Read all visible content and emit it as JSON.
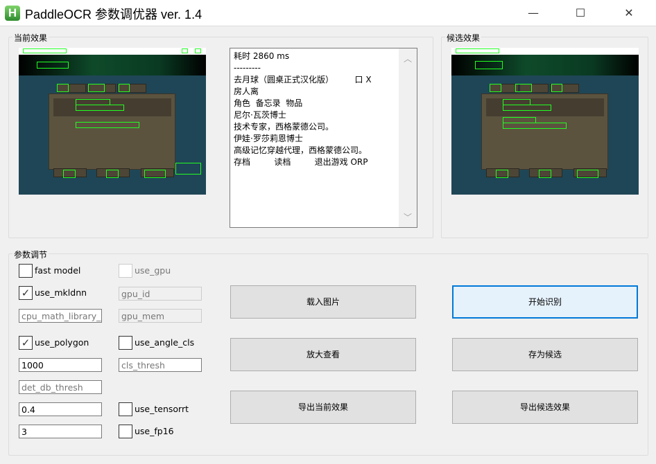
{
  "window": {
    "title": "PaddleOCR 参数调优器 ver. 1.4",
    "app_icon_letter": "H",
    "minimize": "—",
    "maximize": "☐",
    "close": "✕"
  },
  "current": {
    "label": "当前效果"
  },
  "candidate": {
    "label": "候选效果"
  },
  "ocr_output": {
    "lines": [
      "耗时 2860 ms",
      "---------",
      "去月球（圆桌正式汉化版）        口 X",
      "房人离",
      "角色  备忘录  物品",
      "尼尔·瓦茨博士",
      "技术专家，西格蒙德公司。",
      "伊娃·罗莎莉恩博士",
      "高级记忆穿越代理，西格蒙德公司。",
      "存档         读档         退出游戏 ORP"
    ]
  },
  "params": {
    "label": "参数调节",
    "fast_model": {
      "label": "fast model",
      "checked": false
    },
    "use_gpu": {
      "label": "use_gpu",
      "checked": false,
      "disabled": true
    },
    "use_mkldnn": {
      "label": "use_mkldnn",
      "checked": true
    },
    "gpu_id": {
      "placeholder": "gpu_id"
    },
    "cpu_math_library_num_threads": {
      "placeholder": "cpu_math_library_nu"
    },
    "gpu_mem": {
      "placeholder": "gpu_mem"
    },
    "use_polygon": {
      "label": "use_polygon",
      "checked": true
    },
    "use_angle_cls": {
      "label": "use_angle_cls",
      "checked": false
    },
    "max_side": {
      "value": "1000"
    },
    "cls_thresh": {
      "placeholder": "cls_thresh"
    },
    "det_db_thresh": {
      "placeholder": "det_db_thresh"
    },
    "box_thresh": {
      "value": "0.4"
    },
    "use_tensorrt": {
      "label": "use_tensorrt",
      "checked": false
    },
    "unclip": {
      "value": "3"
    },
    "use_fp16": {
      "label": "use_fp16",
      "checked": false
    }
  },
  "buttons": {
    "load": "载入图片",
    "start": "开始识别",
    "zoom": "放大查看",
    "save_candidate": "存为候选",
    "export_current": "导出当前效果",
    "export_candidate": "导出候选效果"
  },
  "icons": {
    "check": "✓",
    "scroll_up": "︿",
    "scroll_down": "﹀"
  }
}
